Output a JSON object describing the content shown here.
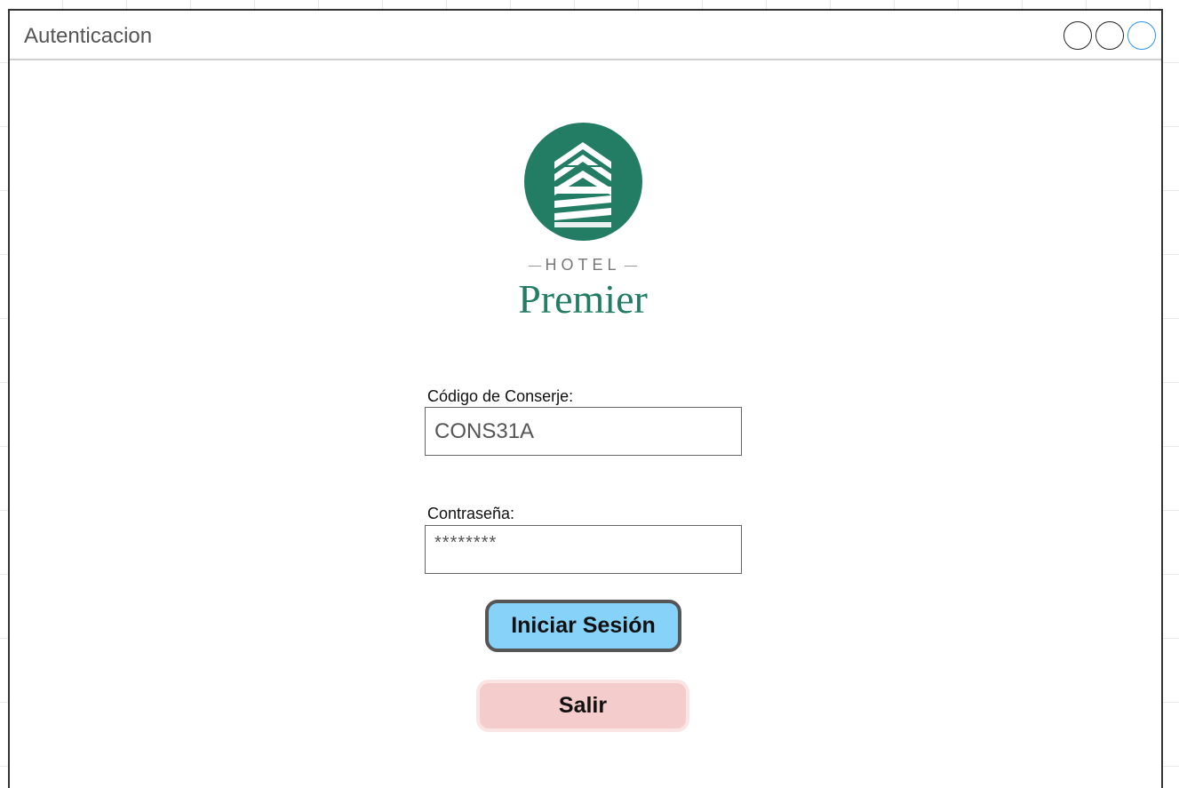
{
  "window": {
    "title": "Autenticacion"
  },
  "brand": {
    "hotel": "HOTEL",
    "name": "Premier",
    "color": "#237d64"
  },
  "form": {
    "code_label": "Código de Conserje:",
    "code_value": "CONS31A",
    "password_label": "Contraseña:",
    "password_value": "********"
  },
  "buttons": {
    "login_label": "Iniciar Sesión",
    "exit_label": "Salir"
  },
  "colors": {
    "login_bg": "#87d2f9",
    "exit_bg": "#f5cccc",
    "active_window_control": "#2e93e8"
  },
  "icons": {
    "logo": "hotel-building-logo",
    "window_controls": [
      "minimize-circle-icon",
      "maximize-circle-icon",
      "close-circle-icon"
    ]
  }
}
